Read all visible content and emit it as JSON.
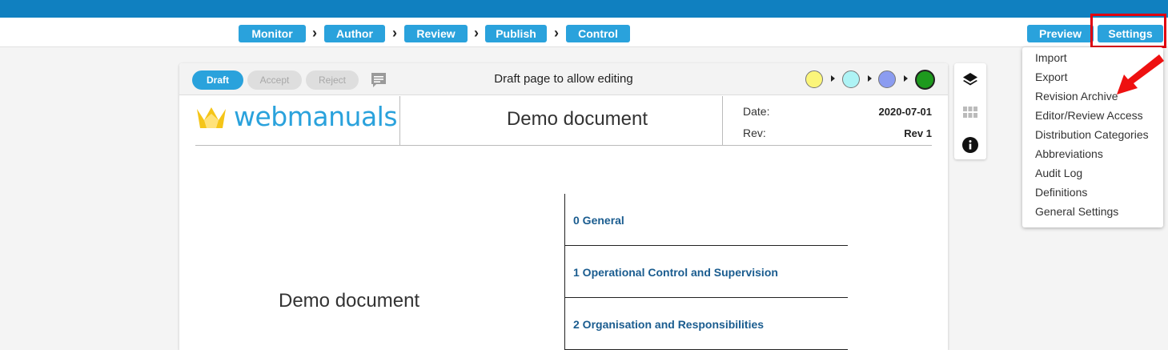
{
  "workflow": {
    "steps": [
      "Monitor",
      "Author",
      "Review",
      "Publish",
      "Control"
    ],
    "arrow": "›"
  },
  "top_buttons": {
    "preview": "Preview",
    "settings": "Settings"
  },
  "settings_menu": {
    "items": [
      "Import",
      "Export",
      "Revision Archive",
      "Editor/Review Access",
      "Distribution Categories",
      "Abbreviations",
      "Audit Log",
      "Definitions",
      "General Settings"
    ]
  },
  "doc_toolbar": {
    "draft": "Draft",
    "accept": "Accept",
    "reject": "Reject",
    "status": "Draft page to allow editing",
    "stage_colors": [
      "#fbf57a",
      "#aef3f5",
      "#8b9cf0",
      "#1e9a1e"
    ]
  },
  "document": {
    "logo": "webmanuals",
    "title": "Demo document",
    "date_label": "Date:",
    "date_value": "2020-07-01",
    "rev_label": "Rev:",
    "rev_value": "Rev 1",
    "cover_title": "Demo document",
    "toc": [
      "0 General",
      "1 Operational Control and Supervision",
      "2 Organisation and Responsibilities"
    ]
  },
  "side_tools": [
    "layers-icon",
    "grid-icon",
    "info-icon"
  ],
  "colors": {
    "topbar": "#1080c0",
    "accent": "#2aa2dc",
    "highlight": "#e0000f"
  }
}
